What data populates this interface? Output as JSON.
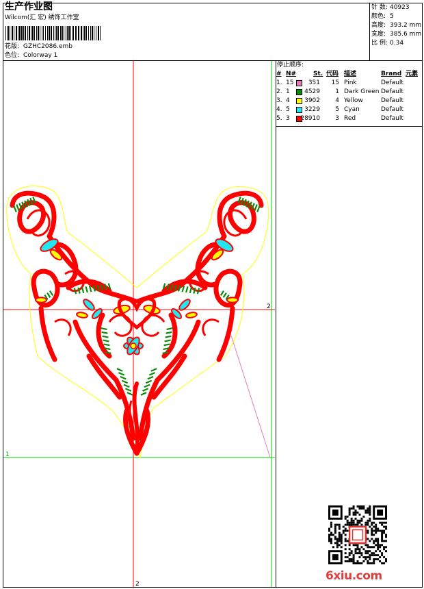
{
  "header": {
    "title": "生产作业图",
    "company": "Wilcom(汇 宏) 绣饰工作室",
    "design_label": "花版:",
    "design_value": "GZHC2086.emb",
    "colorway_label": "色位:",
    "colorway_value": "Colorway 1"
  },
  "stats": [
    {
      "label": "针 数:",
      "value": "40923"
    },
    {
      "label": "颜色:",
      "value": "5"
    },
    {
      "label": "高度:",
      "value": "393.2 mm"
    },
    {
      "label": "宽度:",
      "value": "385.6 mm"
    },
    {
      "label": "比 例:",
      "value": "0.34"
    }
  ],
  "stop_sequence": {
    "title": "停止顺序:",
    "headers": [
      "#",
      "N#",
      "St.",
      "代码",
      "描述",
      "Brand",
      "元素"
    ],
    "rows": [
      {
        "index": "1.",
        "n": "15",
        "color": "#e879b8",
        "stitches": "351",
        "code": "15",
        "desc": "Pink",
        "brand": "Default"
      },
      {
        "index": "2.",
        "n": "1",
        "color": "#0a8a0a",
        "stitches": "4529",
        "code": "1",
        "desc": "Dark Green",
        "brand": "Default"
      },
      {
        "index": "3.",
        "n": "4",
        "color": "#ffff00",
        "stitches": "3902",
        "code": "4",
        "desc": "Yellow",
        "brand": "Default"
      },
      {
        "index": "4.",
        "n": "5",
        "color": "#22e6f0",
        "stitches": "3229",
        "code": "5",
        "desc": "Cyan",
        "brand": "Default"
      },
      {
        "index": "5.",
        "n": "3",
        "color": "#ff0000",
        "stitches": "28910",
        "code": "3",
        "desc": "Red",
        "brand": "Default"
      }
    ]
  },
  "canvas": {
    "marker_1": "1",
    "marker_2_right": "2",
    "marker_2_bottom": "2"
  },
  "watermark": "6xiu.com",
  "colors": {
    "red": "#ff0000",
    "green": "#0a8a0a",
    "yellow": "#ffff00",
    "cyan": "#22e6f0",
    "pink": "#e879b8"
  },
  "icons": [
    "barcode-icon",
    "qr-code-icon",
    "seal-stamp-icon"
  ]
}
